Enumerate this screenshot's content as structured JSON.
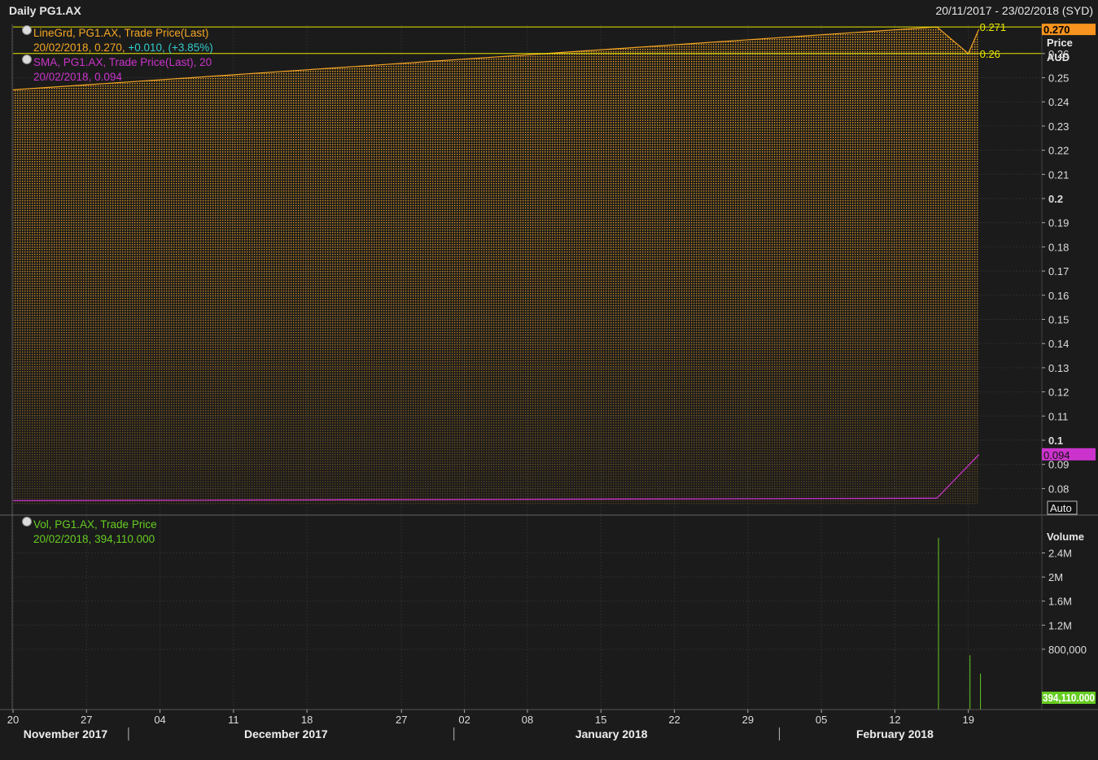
{
  "header": {
    "title": "Daily PG1.AX",
    "range": "20/11/2017 - 23/02/2018 (SYD)"
  },
  "legend": {
    "line": {
      "name": "LineGrd, PG1.AX, Trade Price(Last)",
      "date_value": "20/02/2018, 0.270,",
      "change": "+0.010, (+3.85%)"
    },
    "sma": {
      "name": "SMA, PG1.AX, Trade Price(Last),  20",
      "date_value": "20/02/2018, 0.094"
    },
    "vol": {
      "name": "Vol, PG1.AX, Trade Price",
      "date_value": "20/02/2018, 394,110.000"
    }
  },
  "colors": {
    "background": "#1b1b1b",
    "grid": "#2e2e2e",
    "price": "#f5a623",
    "sma": "#cc33cc",
    "volume": "#66cc22",
    "hline": "#e8e800",
    "text": "#dddddd",
    "change": "#33cccc"
  },
  "chart_data": [
    {
      "type": "area",
      "title": "",
      "ylabel": "Price",
      "unit": "AUD",
      "ylim": [
        0.075,
        0.277
      ],
      "yticks": [
        "0.08",
        "0.09",
        "0.1",
        "0.11",
        "0.12",
        "0.13",
        "0.14",
        "0.15",
        "0.16",
        "0.17",
        "0.18",
        "0.19",
        "0.2",
        "0.21",
        "0.22",
        "0.23",
        "0.24",
        "0.25",
        "0.26"
      ],
      "series": [
        {
          "name": "LineGrd, PG1.AX, Trade Price(Last)",
          "x": [
            "2017-11-20",
            "2018-02-16",
            "2018-02-19",
            "2018-02-20"
          ],
          "y": [
            0.245,
            0.271,
            0.26,
            0.27
          ]
        },
        {
          "name": "SMA, PG1.AX, Trade Price(Last), 20",
          "x": [
            "2017-11-20",
            "2018-02-16",
            "2018-02-20"
          ],
          "y": [
            0.075,
            0.076,
            0.094
          ]
        }
      ],
      "hlines": [
        {
          "value": 0.271,
          "label": "0.271"
        },
        {
          "value": 0.26,
          "label": "0.26"
        }
      ],
      "last_value_tags": [
        {
          "value": 0.27,
          "label": "0.270"
        },
        {
          "value": 0.094,
          "label": "0.094"
        }
      ],
      "scale_mode": "Auto",
      "grid": true
    },
    {
      "type": "bar",
      "title": "",
      "ylabel": "Volume",
      "ylim": [
        0,
        2800000
      ],
      "yticks": [
        "800,000",
        "1.2M",
        "1.6M",
        "2M",
        "2.4M"
      ],
      "x": [
        "2018-02-16",
        "2018-02-19",
        "2018-02-20"
      ],
      "values": [
        2650000,
        700000,
        394110
      ],
      "last_value_tag": "394,110.000",
      "grid": true
    }
  ],
  "xaxis": {
    "start": "2017-11-20",
    "end": "2018-02-23",
    "day_ticks": [
      {
        "date": "2017-11-20",
        "label": "20"
      },
      {
        "date": "2017-11-27",
        "label": "27"
      },
      {
        "date": "2017-12-04",
        "label": "04"
      },
      {
        "date": "2017-12-11",
        "label": "11"
      },
      {
        "date": "2017-12-18",
        "label": "18"
      },
      {
        "date": "2017-12-27",
        "label": "27"
      },
      {
        "date": "2018-01-02",
        "label": "02"
      },
      {
        "date": "2018-01-08",
        "label": "08"
      },
      {
        "date": "2018-01-15",
        "label": "15"
      },
      {
        "date": "2018-01-22",
        "label": "22"
      },
      {
        "date": "2018-01-29",
        "label": "29"
      },
      {
        "date": "2018-02-05",
        "label": "05"
      },
      {
        "date": "2018-02-12",
        "label": "12"
      },
      {
        "date": "2018-02-19",
        "label": "19"
      }
    ],
    "months": [
      {
        "label": "November 2017",
        "start": "2017-11-20",
        "end": "2017-11-30"
      },
      {
        "label": "December 2017",
        "start": "2017-12-01",
        "end": "2017-12-31"
      },
      {
        "label": "January 2018",
        "start": "2018-01-01",
        "end": "2018-01-31"
      },
      {
        "label": "February 2018",
        "start": "2018-02-01",
        "end": "2018-02-23"
      }
    ]
  }
}
